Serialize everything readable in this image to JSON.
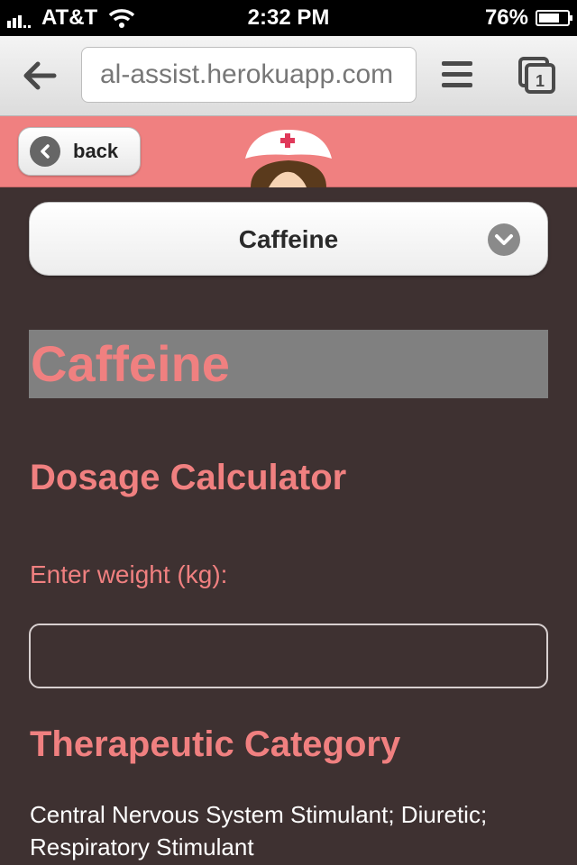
{
  "status_bar": {
    "carrier": "AT&T",
    "time": "2:32 PM",
    "battery_text": "76%",
    "battery_level": 0.76
  },
  "browser": {
    "url": "al-assist.herokuapp.com",
    "tab_count": "1"
  },
  "header": {
    "back_label": "back"
  },
  "drug_select": {
    "selected": "Caffeine"
  },
  "drug": {
    "name": "Caffeine",
    "dosage_heading": "Dosage Calculator",
    "weight_label": "Enter weight (kg):",
    "weight_value": "",
    "category_heading": "Therapeutic Category",
    "category_text": "Central Nervous System Stimulant; Diuretic; Respiratory Stimulant"
  },
  "colors": {
    "accent": "#f08080",
    "background": "#3e3131",
    "title_bg": "#808080"
  }
}
